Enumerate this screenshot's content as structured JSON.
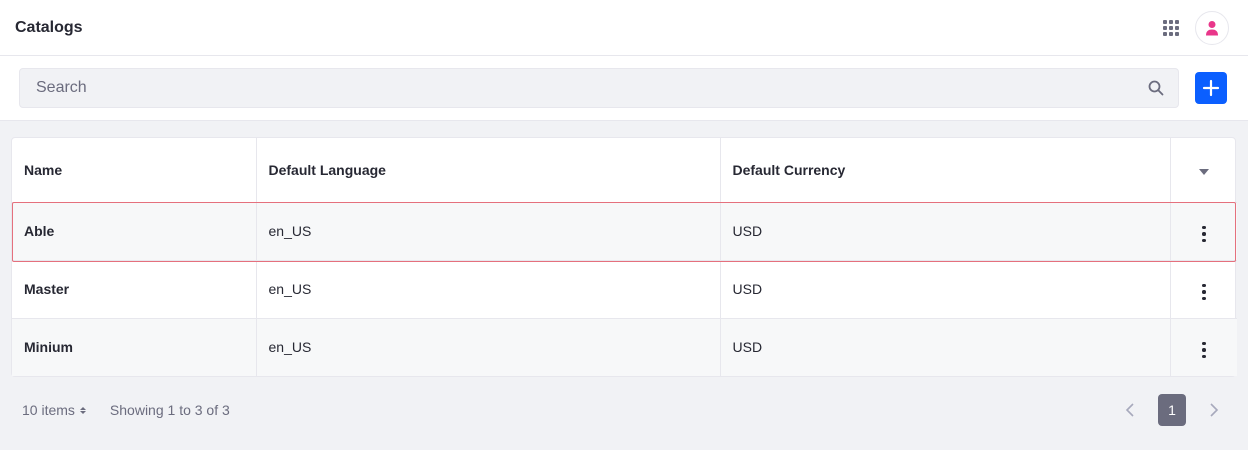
{
  "header": {
    "title": "Catalogs"
  },
  "search": {
    "placeholder": "Search"
  },
  "table": {
    "columns": [
      "Name",
      "Default Language",
      "Default Currency"
    ],
    "rows": [
      {
        "name": "Able",
        "language": "en_US",
        "currency": "USD"
      },
      {
        "name": "Master",
        "language": "en_US",
        "currency": "USD"
      },
      {
        "name": "Minium",
        "language": "en_US",
        "currency": "USD"
      }
    ]
  },
  "footer": {
    "items_per_page": "10 items",
    "showing": "Showing 1 to 3 of 3",
    "current_page": "1"
  },
  "colors": {
    "accent": "#0b5fff",
    "highlight": "#e5707d",
    "avatar_icon": "#e9368a"
  },
  "icons": {
    "apps": "apps-grid-icon",
    "avatar": "user-icon",
    "search": "search-icon",
    "add": "plus-icon",
    "sort": "caret-down-icon",
    "row_actions": "kebab-icon",
    "prev": "chevron-left-icon",
    "next": "chevron-right-icon"
  }
}
